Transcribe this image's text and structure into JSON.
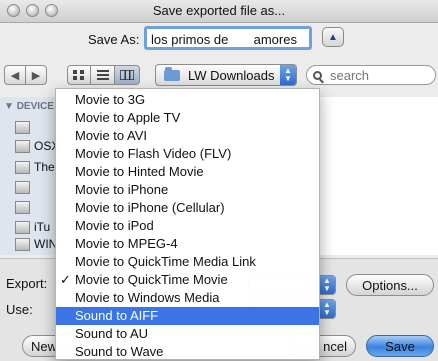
{
  "window": {
    "title": "Save exported file as..."
  },
  "save_as": {
    "label": "Save As:",
    "value": "los primos de       amores"
  },
  "location": {
    "current": "LW Downloads"
  },
  "search": {
    "placeholder": "search"
  },
  "sidebar": {
    "heading": "DEVICE",
    "items": [
      "",
      "OSX",
      "The",
      "",
      "",
      "iTu",
      "WIN"
    ]
  },
  "bottom": {
    "export_label": "Export:",
    "use_label": "Use:",
    "options_button": "Options...",
    "new_folder_button": "New",
    "cancel_button": "ncel",
    "save_button": "Save"
  },
  "export_menu": {
    "items": [
      "Movie to 3G",
      "Movie to Apple TV",
      "Movie to AVI",
      "Movie to Flash Video (FLV)",
      "Movie to Hinted Movie",
      "Movie to iPhone",
      "Movie to iPhone (Cellular)",
      "Movie to iPod",
      "Movie to MPEG-4",
      "Movie to QuickTime Media Link",
      "Movie to QuickTime Movie",
      "Movie to Windows Media",
      "Sound to AIFF",
      "Sound to AU",
      "Sound to Wave"
    ],
    "checked": "Movie to QuickTime Movie",
    "highlighted": "Sound to AIFF",
    "check_glyph": "✓"
  },
  "colors": {
    "highlight": "#3b74e6",
    "accent_blue": "#2d6cd0"
  }
}
